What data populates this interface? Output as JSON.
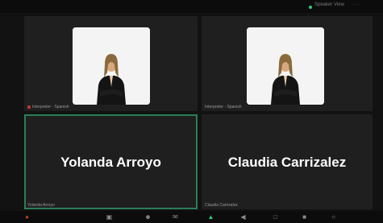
{
  "topbar": {
    "meeting_label": "Speaker View",
    "right_label": "· · ·"
  },
  "participants": [
    {
      "display_name": "Yolanda Arroyo",
      "tile_label": "Yolanda Arroyo",
      "active": true
    },
    {
      "display_name": "Claudia Carrizalez",
      "tile_label": "Claudia Carrizalez",
      "active": false
    }
  ],
  "top_tiles": [
    {
      "label": "Interpreter - Spanish"
    },
    {
      "label": "Interpreter - Spanish"
    }
  ],
  "toolbar": {
    "icons": [
      "mic-icon",
      "video-icon",
      "participants-icon",
      "chat-icon",
      "share-icon",
      "record-icon",
      "reactions-icon",
      "apps-icon",
      "more-icon",
      "leave-icon"
    ]
  },
  "colors": {
    "active_border": "#2d7d57",
    "tile_bg": "#1f1f1f",
    "page_bg": "#101010"
  }
}
